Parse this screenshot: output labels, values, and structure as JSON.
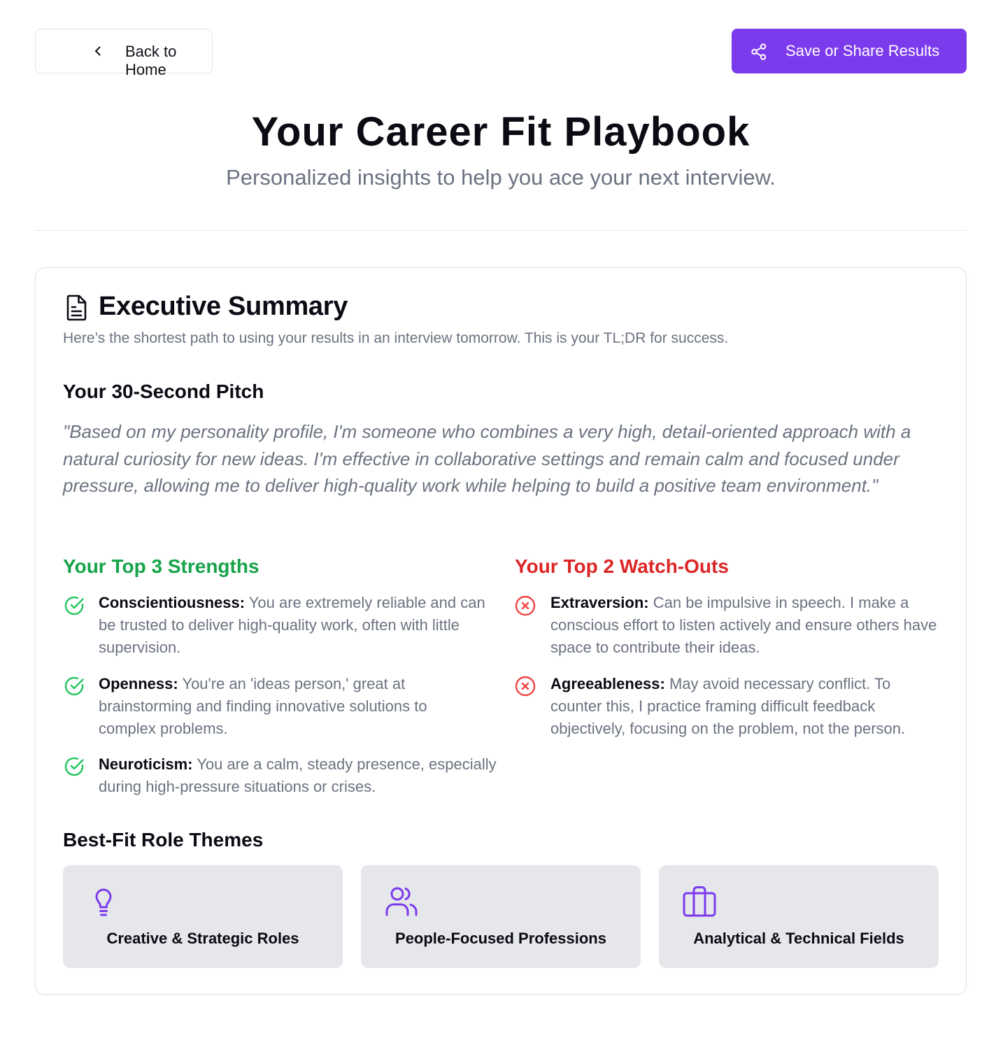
{
  "nav": {
    "back_label": "Back to Home",
    "share_label": "Save or Share Results"
  },
  "header": {
    "title": "Your Career Fit Playbook",
    "subtitle": "Personalized insights to help you ace your next interview."
  },
  "summary": {
    "title": "Executive Summary",
    "description": "Here’s the shortest path to using your results in an interview tomorrow. This is your TL;DR for success.",
    "pitch_heading": "Your 30-Second Pitch",
    "pitch_text": "\"Based on my personality profile, I'm someone who combines a very high, detail-oriented approach with a natural curiosity for new ideas. I'm effective in collaborative settings and remain calm and focused under pressure, allowing me to deliver high-quality work while helping to build a positive team environment.\""
  },
  "strengths": {
    "heading": "Your Top 3 Strengths",
    "items": [
      {
        "trait": "Conscientiousness:",
        "text": "You are extremely reliable and can be trusted to deliver high-quality work, often with little supervision."
      },
      {
        "trait": "Openness:",
        "text": "You're an 'ideas person,' great at brainstorming and finding innovative solutions to complex problems."
      },
      {
        "trait": "Neuroticism:",
        "text": "You are a calm, steady presence, especially during high-pressure situations or crises."
      }
    ]
  },
  "watchouts": {
    "heading": "Your Top 2 Watch-Outs",
    "items": [
      {
        "trait": "Extraversion:",
        "text": "Can be impulsive in speech. I make a conscious effort to listen actively and ensure others have space to contribute their ideas."
      },
      {
        "trait": "Agreeableness:",
        "text": "May avoid necessary conflict. To counter this, I practice framing difficult feedback objectively, focusing on the problem, not the person."
      }
    ]
  },
  "roles": {
    "heading": "Best-Fit Role Themes",
    "items": [
      {
        "label": "Creative & Strategic Roles",
        "icon": "lightbulb-icon"
      },
      {
        "label": "People-Focused Professions",
        "icon": "users-icon"
      },
      {
        "label": "Analytical & Technical Fields",
        "icon": "briefcase-icon"
      }
    ]
  },
  "colors": {
    "accent": "#7c3aed",
    "strength": "#16a34a",
    "watchout": "#dc2626",
    "muted_text": "#6b7280"
  }
}
